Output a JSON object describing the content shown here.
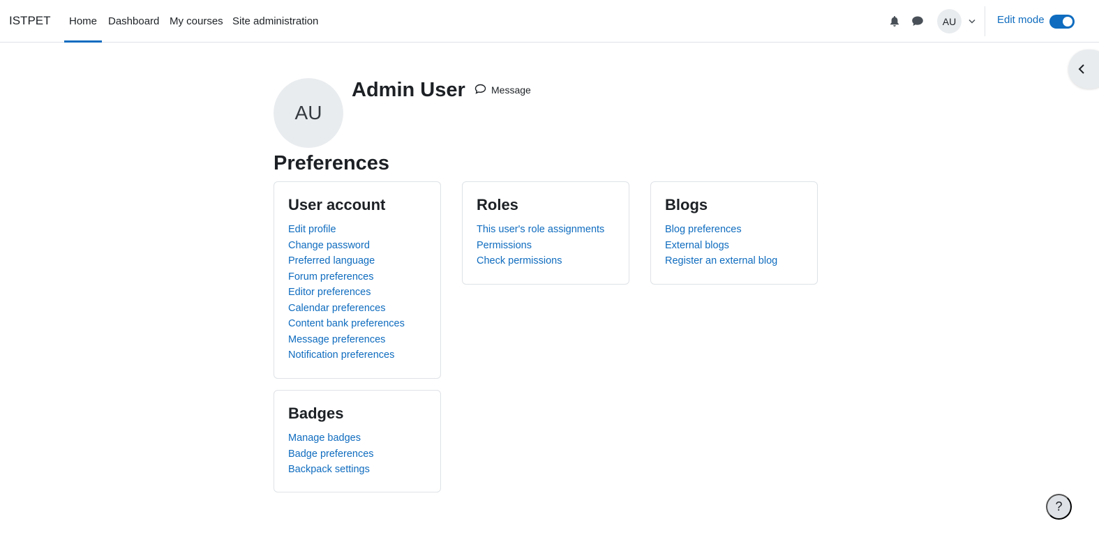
{
  "navbar": {
    "brand": "ISTPET",
    "items": [
      {
        "label": "Home"
      },
      {
        "label": "Dashboard"
      },
      {
        "label": "My courses"
      },
      {
        "label": "Site administration"
      }
    ],
    "user_initials": "AU",
    "edit_mode_label": "Edit mode",
    "edit_mode_on": true,
    "icons": {
      "notifications": "bell-icon",
      "messages": "chat-icon"
    }
  },
  "profile": {
    "initials": "AU",
    "name": "Admin User",
    "message_label": "Message"
  },
  "page": {
    "title": "Preferences"
  },
  "cards": {
    "user_account": {
      "title": "User account",
      "links": [
        "Edit profile",
        "Change password",
        "Preferred language",
        "Forum preferences",
        "Editor preferences",
        "Calendar preferences",
        "Content bank preferences",
        "Message preferences",
        "Notification preferences"
      ]
    },
    "roles": {
      "title": "Roles",
      "links": [
        "This user's role assignments",
        "Permissions",
        "Check permissions"
      ]
    },
    "blogs": {
      "title": "Blogs",
      "links": [
        "Blog preferences",
        "External blogs",
        "Register an external blog"
      ]
    },
    "badges": {
      "title": "Badges",
      "links": [
        "Manage badges",
        "Badge preferences",
        "Backpack settings"
      ]
    }
  },
  "help": {
    "label": "?"
  },
  "colors": {
    "accent": "#0f6cbf",
    "text": "#1d2125",
    "muted_bg": "#e9ecef",
    "border": "#dee2e6"
  }
}
